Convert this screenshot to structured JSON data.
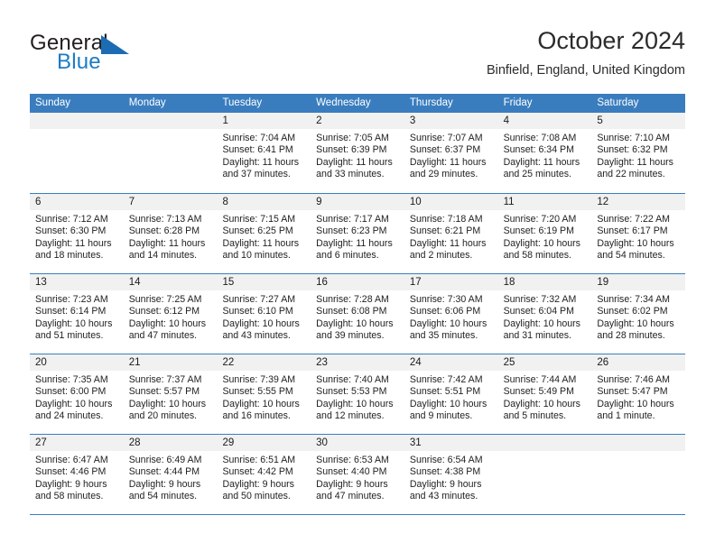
{
  "brand": {
    "word1": "General",
    "word2": "Blue",
    "logo_icon": "triangle-logo-icon",
    "accent_color": "#1c7cc4"
  },
  "header": {
    "title": "October 2024",
    "subtitle": "Binfield, England, United Kingdom"
  },
  "calendar": {
    "header_color": "#3a7dbf",
    "daynum_band_color": "#f1f1f1",
    "weekdays": [
      "Sunday",
      "Monday",
      "Tuesday",
      "Wednesday",
      "Thursday",
      "Friday",
      "Saturday"
    ],
    "weeks": [
      [
        {
          "day": "",
          "sunrise": "",
          "sunset": "",
          "daylight": "",
          "empty": true
        },
        {
          "day": "",
          "sunrise": "",
          "sunset": "",
          "daylight": "",
          "empty": true
        },
        {
          "day": "1",
          "sunrise": "Sunrise: 7:04 AM",
          "sunset": "Sunset: 6:41 PM",
          "daylight": "Daylight: 11 hours and 37 minutes."
        },
        {
          "day": "2",
          "sunrise": "Sunrise: 7:05 AM",
          "sunset": "Sunset: 6:39 PM",
          "daylight": "Daylight: 11 hours and 33 minutes."
        },
        {
          "day": "3",
          "sunrise": "Sunrise: 7:07 AM",
          "sunset": "Sunset: 6:37 PM",
          "daylight": "Daylight: 11 hours and 29 minutes."
        },
        {
          "day": "4",
          "sunrise": "Sunrise: 7:08 AM",
          "sunset": "Sunset: 6:34 PM",
          "daylight": "Daylight: 11 hours and 25 minutes."
        },
        {
          "day": "5",
          "sunrise": "Sunrise: 7:10 AM",
          "sunset": "Sunset: 6:32 PM",
          "daylight": "Daylight: 11 hours and 22 minutes."
        }
      ],
      [
        {
          "day": "6",
          "sunrise": "Sunrise: 7:12 AM",
          "sunset": "Sunset: 6:30 PM",
          "daylight": "Daylight: 11 hours and 18 minutes."
        },
        {
          "day": "7",
          "sunrise": "Sunrise: 7:13 AM",
          "sunset": "Sunset: 6:28 PM",
          "daylight": "Daylight: 11 hours and 14 minutes."
        },
        {
          "day": "8",
          "sunrise": "Sunrise: 7:15 AM",
          "sunset": "Sunset: 6:25 PM",
          "daylight": "Daylight: 11 hours and 10 minutes."
        },
        {
          "day": "9",
          "sunrise": "Sunrise: 7:17 AM",
          "sunset": "Sunset: 6:23 PM",
          "daylight": "Daylight: 11 hours and 6 minutes."
        },
        {
          "day": "10",
          "sunrise": "Sunrise: 7:18 AM",
          "sunset": "Sunset: 6:21 PM",
          "daylight": "Daylight: 11 hours and 2 minutes."
        },
        {
          "day": "11",
          "sunrise": "Sunrise: 7:20 AM",
          "sunset": "Sunset: 6:19 PM",
          "daylight": "Daylight: 10 hours and 58 minutes."
        },
        {
          "day": "12",
          "sunrise": "Sunrise: 7:22 AM",
          "sunset": "Sunset: 6:17 PM",
          "daylight": "Daylight: 10 hours and 54 minutes."
        }
      ],
      [
        {
          "day": "13",
          "sunrise": "Sunrise: 7:23 AM",
          "sunset": "Sunset: 6:14 PM",
          "daylight": "Daylight: 10 hours and 51 minutes."
        },
        {
          "day": "14",
          "sunrise": "Sunrise: 7:25 AM",
          "sunset": "Sunset: 6:12 PM",
          "daylight": "Daylight: 10 hours and 47 minutes."
        },
        {
          "day": "15",
          "sunrise": "Sunrise: 7:27 AM",
          "sunset": "Sunset: 6:10 PM",
          "daylight": "Daylight: 10 hours and 43 minutes."
        },
        {
          "day": "16",
          "sunrise": "Sunrise: 7:28 AM",
          "sunset": "Sunset: 6:08 PM",
          "daylight": "Daylight: 10 hours and 39 minutes."
        },
        {
          "day": "17",
          "sunrise": "Sunrise: 7:30 AM",
          "sunset": "Sunset: 6:06 PM",
          "daylight": "Daylight: 10 hours and 35 minutes."
        },
        {
          "day": "18",
          "sunrise": "Sunrise: 7:32 AM",
          "sunset": "Sunset: 6:04 PM",
          "daylight": "Daylight: 10 hours and 31 minutes."
        },
        {
          "day": "19",
          "sunrise": "Sunrise: 7:34 AM",
          "sunset": "Sunset: 6:02 PM",
          "daylight": "Daylight: 10 hours and 28 minutes."
        }
      ],
      [
        {
          "day": "20",
          "sunrise": "Sunrise: 7:35 AM",
          "sunset": "Sunset: 6:00 PM",
          "daylight": "Daylight: 10 hours and 24 minutes."
        },
        {
          "day": "21",
          "sunrise": "Sunrise: 7:37 AM",
          "sunset": "Sunset: 5:57 PM",
          "daylight": "Daylight: 10 hours and 20 minutes."
        },
        {
          "day": "22",
          "sunrise": "Sunrise: 7:39 AM",
          "sunset": "Sunset: 5:55 PM",
          "daylight": "Daylight: 10 hours and 16 minutes."
        },
        {
          "day": "23",
          "sunrise": "Sunrise: 7:40 AM",
          "sunset": "Sunset: 5:53 PM",
          "daylight": "Daylight: 10 hours and 12 minutes."
        },
        {
          "day": "24",
          "sunrise": "Sunrise: 7:42 AM",
          "sunset": "Sunset: 5:51 PM",
          "daylight": "Daylight: 10 hours and 9 minutes."
        },
        {
          "day": "25",
          "sunrise": "Sunrise: 7:44 AM",
          "sunset": "Sunset: 5:49 PM",
          "daylight": "Daylight: 10 hours and 5 minutes."
        },
        {
          "day": "26",
          "sunrise": "Sunrise: 7:46 AM",
          "sunset": "Sunset: 5:47 PM",
          "daylight": "Daylight: 10 hours and 1 minute."
        }
      ],
      [
        {
          "day": "27",
          "sunrise": "Sunrise: 6:47 AM",
          "sunset": "Sunset: 4:46 PM",
          "daylight": "Daylight: 9 hours and 58 minutes."
        },
        {
          "day": "28",
          "sunrise": "Sunrise: 6:49 AM",
          "sunset": "Sunset: 4:44 PM",
          "daylight": "Daylight: 9 hours and 54 minutes."
        },
        {
          "day": "29",
          "sunrise": "Sunrise: 6:51 AM",
          "sunset": "Sunset: 4:42 PM",
          "daylight": "Daylight: 9 hours and 50 minutes."
        },
        {
          "day": "30",
          "sunrise": "Sunrise: 6:53 AM",
          "sunset": "Sunset: 4:40 PM",
          "daylight": "Daylight: 9 hours and 47 minutes."
        },
        {
          "day": "31",
          "sunrise": "Sunrise: 6:54 AM",
          "sunset": "Sunset: 4:38 PM",
          "daylight": "Daylight: 9 hours and 43 minutes."
        },
        {
          "day": "",
          "sunrise": "",
          "sunset": "",
          "daylight": "",
          "empty": true
        },
        {
          "day": "",
          "sunrise": "",
          "sunset": "",
          "daylight": "",
          "empty": true
        }
      ]
    ]
  }
}
